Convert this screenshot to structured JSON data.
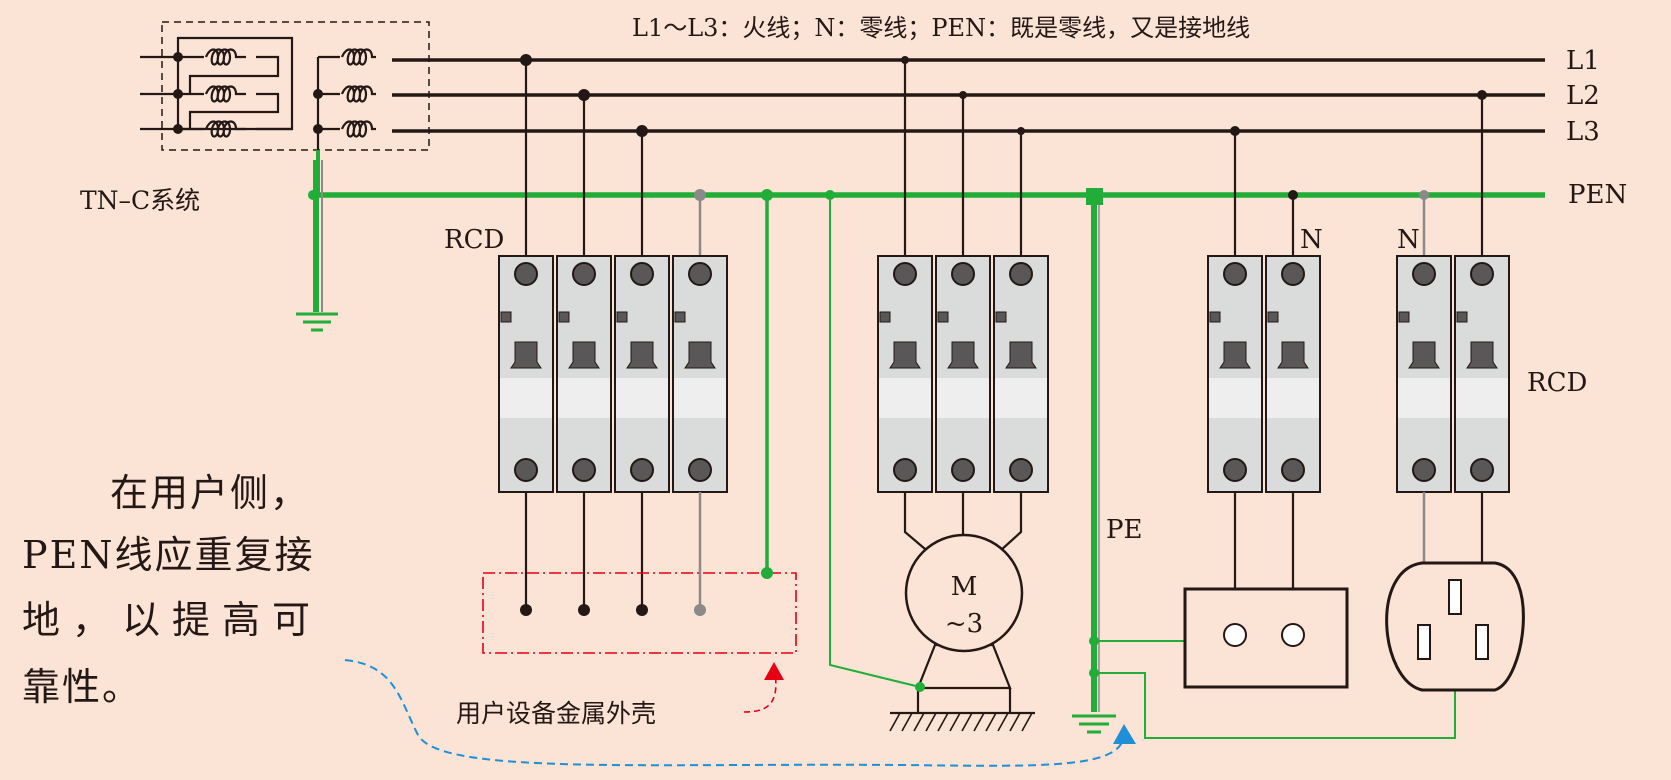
{
  "diagram": {
    "legend": "L1～L3：火线；N：零线；PEN：既是零线，又是接地线",
    "system_label": "TN–C系统",
    "line_labels": {
      "l1": "L1",
      "l2": "L2",
      "l3": "L3",
      "pen": "PEN"
    },
    "rcd_left": "RCD",
    "rcd_right": "RCD",
    "n_label_a": "N",
    "n_label_b": "N",
    "pe_label": "PE",
    "motor_top": "M",
    "motor_bottom": "~3",
    "enclosure_label": "用户设备金属外壳",
    "note_lines": [
      "在用户侧，",
      "PEN线应重复接",
      "地，以提高可",
      "靠性。"
    ],
    "colors": {
      "background": "#fbe3d5",
      "pen_green": "#22ac38",
      "wire_black": "#231815",
      "neutral_grey": "#8a8a8a",
      "enclosure_red": "#e60012",
      "callout_blue": "#1f8fd8"
    }
  }
}
